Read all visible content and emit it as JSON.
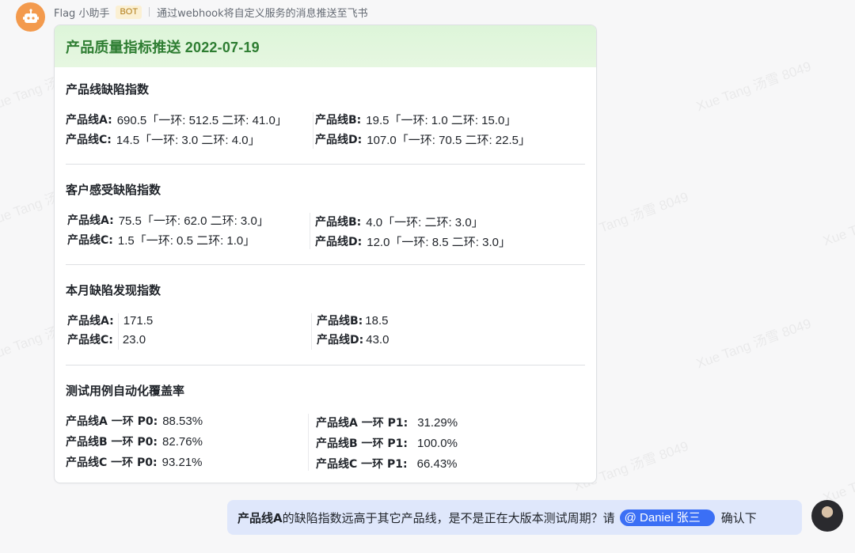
{
  "sender": {
    "name": "Flag 小助手",
    "badge": "BOT",
    "description": "通过webhook将自定义服务的消息推送至飞书"
  },
  "card": {
    "title": "产品质量指标推送 2022-07-19",
    "sections": [
      {
        "title": "产品线缺陷指数",
        "rows": [
          [
            {
              "k": "产品线A:",
              "v": "690.5「一环: 512.5 二环: 41.0」"
            },
            {
              "k": "产品线B:",
              "v": "19.5「一环: 1.0 二环: 15.0」"
            }
          ],
          [
            {
              "k": "产品线C:",
              "v": "14.5「一环: 3.0 二环: 4.0」"
            },
            {
              "k": "产品线D:",
              "v": "107.0「一环: 70.5 二环: 22.5」"
            }
          ]
        ]
      },
      {
        "title": "客户感受缺陷指数",
        "rows": [
          [
            {
              "k": "产品线A:",
              "v": "75.5「一环: 62.0 二环: 3.0」"
            },
            {
              "k": "产品线B:",
              "v": "4.0「一环:  二环: 3.0」"
            }
          ],
          [
            {
              "k": "产品线C:",
              "v": "1.5「一环: 0.5 二环: 1.0」"
            },
            {
              "k": "产品线D:",
              "v": "12.0「一环: 8.5 二环: 3.0」"
            }
          ]
        ]
      },
      {
        "title": "本月缺陷发现指数",
        "rows": [
          [
            {
              "k": "产品线A:",
              "v": "171.5"
            },
            {
              "k": "产品线B:",
              "v": "18.5"
            }
          ],
          [
            {
              "k": "产品线C:",
              "v": "23.0"
            },
            {
              "k": "产品线D:",
              "v": "43.0"
            }
          ]
        ]
      },
      {
        "title": "测试用例自动化覆盖率",
        "rows": [
          [
            {
              "k": "产品线A 一环 P0:",
              "v": "88.53%"
            },
            {
              "k": "产品线A 一环 P1:",
              "v": "31.29%"
            }
          ],
          [
            {
              "k": "产品线B 一环 P0:",
              "v": "82.76%"
            },
            {
              "k": "产品线B 一环 P1:",
              "v": "100.0%"
            }
          ],
          [
            {
              "k": "产品线C 一环 P0:",
              "v": "93.21%"
            },
            {
              "k": "产品线C 一环 P1:",
              "v": "66.43%"
            }
          ]
        ]
      }
    ]
  },
  "reply": {
    "bold_prefix": "产品线A",
    "text": " 的缺陷指数远高于其它产品线，是不是正在大版本测试周期？请",
    "mention": "@ Daniel 张三",
    "suffix": "确认下"
  },
  "watermark": "Xue Tang 汤雪 8049",
  "colors": {
    "header_bg": "#e1f6dc",
    "title_green": "#2e7d32",
    "mention_blue": "#3b6ff5",
    "bubble_bg": "#dfe7fb",
    "bot_avatar": "#f39a4d"
  }
}
